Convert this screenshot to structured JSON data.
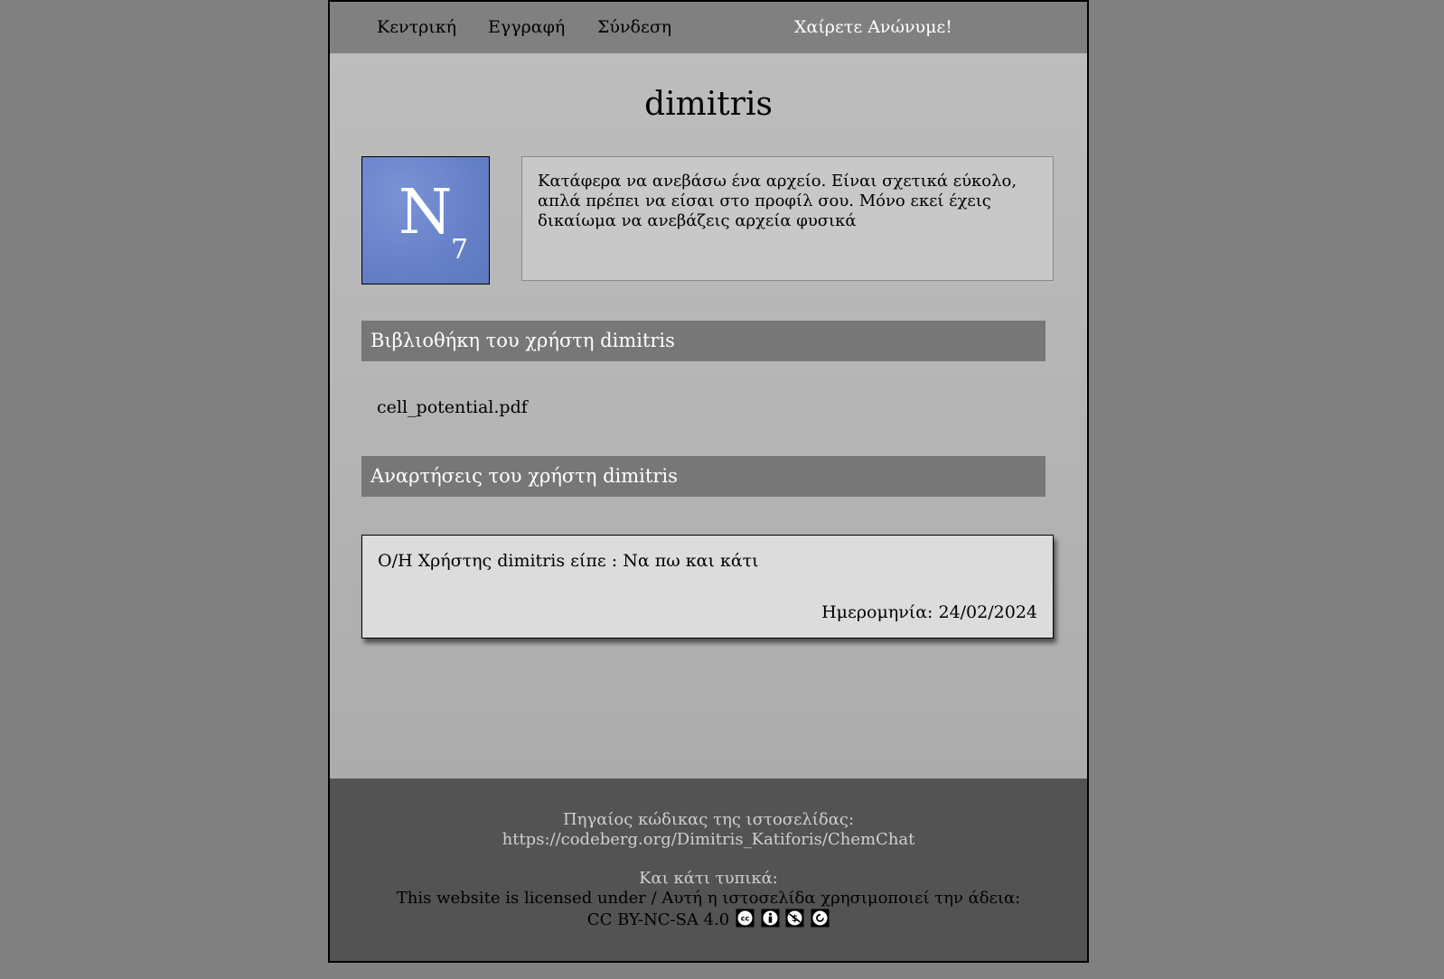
{
  "nav": {
    "home": "Κεντρική",
    "register": "Εγγραφή",
    "login": "Σύνδεση",
    "greeting": "Χαίρετε Ανώνυμε!"
  },
  "profile": {
    "username": "dimitris",
    "avatar_text": "N",
    "avatar_sub": "7",
    "bio": "Κατάφερα να ανεβάσω ένα αρχείο. Είναι σχετικά εύκολο, απλά πρέπει να είσαι στο προφίλ σου. Μόνο εκεί έχεις δικαίωμα να ανεβάζεις αρχεία φυσικά"
  },
  "library": {
    "header": "Βιβλιοθήκη του χρήστη dimitris",
    "files": [
      "cell_potential.pdf"
    ]
  },
  "posts": {
    "header": "Αναρτήσεις του χρήστη dimitris",
    "items": [
      {
        "text": "Ο/Η Χρήστης dimitris είπε : Να πω και κάτι",
        "date": "Ημερομηνία: 24/02/2024"
      }
    ]
  },
  "footer": {
    "source": "Πηγαίος κώδικας της ιστοσελίδας: https://codeberg.org/Dimitris_Katiforis/ChemChat",
    "formal": "Και κάτι τυπικά:",
    "license_prefix": "This website is licensed under / Αυτή η ιστοσελίδα χρησιμοποιεί την άδεια:",
    "license_name": "CC BY-NC-SA 4.0",
    "license_icons": [
      "cc-icon",
      "by-icon",
      "nc-icon",
      "sa-icon"
    ]
  }
}
